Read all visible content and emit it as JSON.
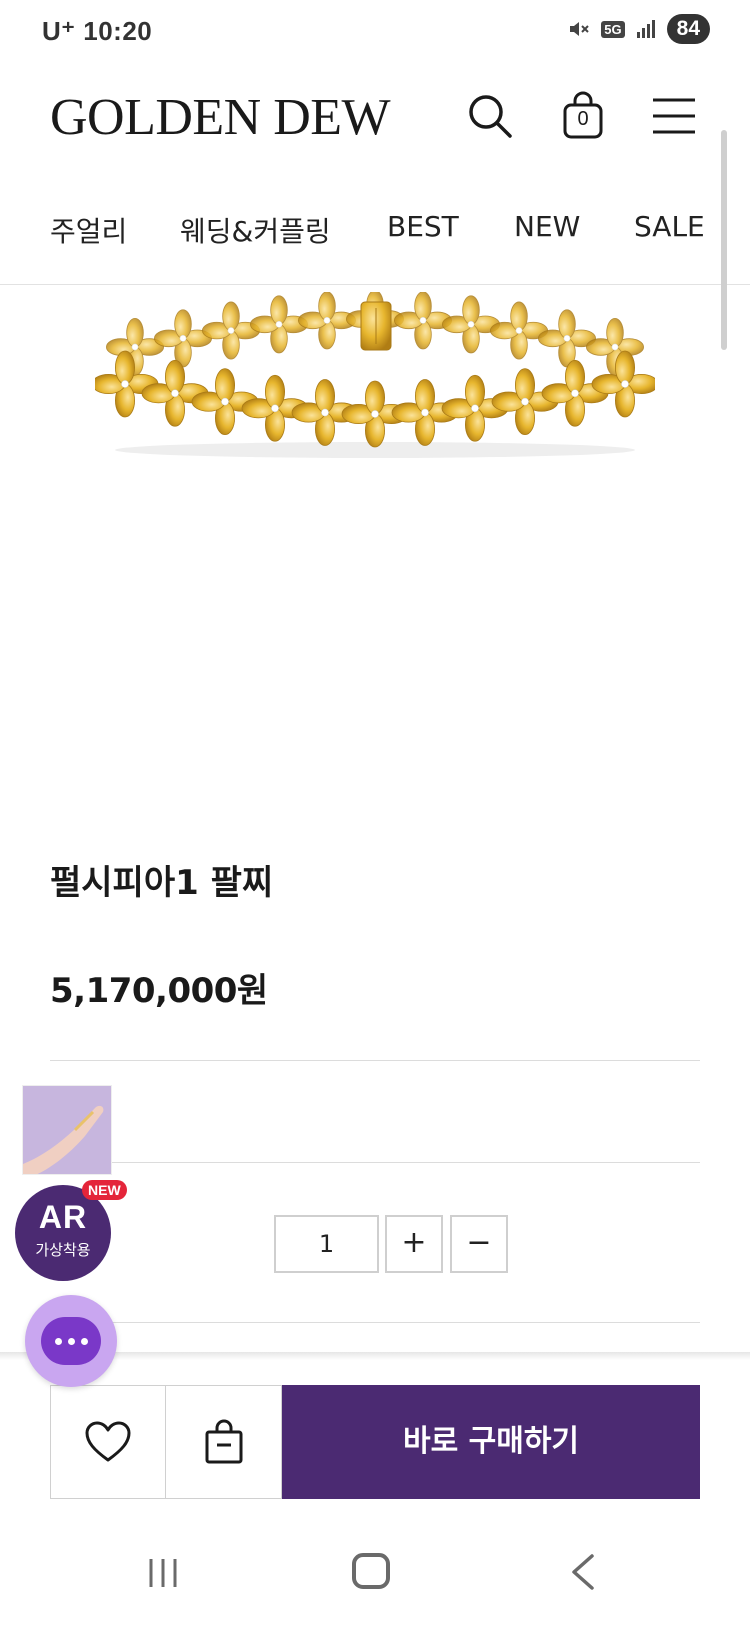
{
  "status": {
    "carrier": "U⁺",
    "time": "10:20",
    "battery": "84",
    "network": "5G"
  },
  "header": {
    "logo": "GOLDEN DEW",
    "cart_count": "0"
  },
  "nav": {
    "items": [
      "주얼리",
      "웨딩&커플링",
      "BEST",
      "NEW",
      "SALE"
    ]
  },
  "product": {
    "name": "펄시피아1 팔찌",
    "price": "5,170,000원"
  },
  "ar": {
    "badge_main": "AR",
    "badge_sub": "가상착용",
    "new_tag": "NEW"
  },
  "quantity": {
    "value": "1",
    "plus": "+",
    "minus": "−"
  },
  "bottom_bar": {
    "buy_label": "바로 구매하기"
  },
  "colors": {
    "brand_purple": "#4b2a72",
    "chat_purple": "#7a38c8",
    "gold": "#e7b62e",
    "new_red": "#e4253a"
  },
  "icons": {
    "search": "search-icon",
    "cart": "shopping-bag-icon",
    "menu": "hamburger-menu-icon",
    "wishlist": "heart-icon",
    "add_cart": "bag-add-icon",
    "chat": "chat-bubble-icon"
  }
}
